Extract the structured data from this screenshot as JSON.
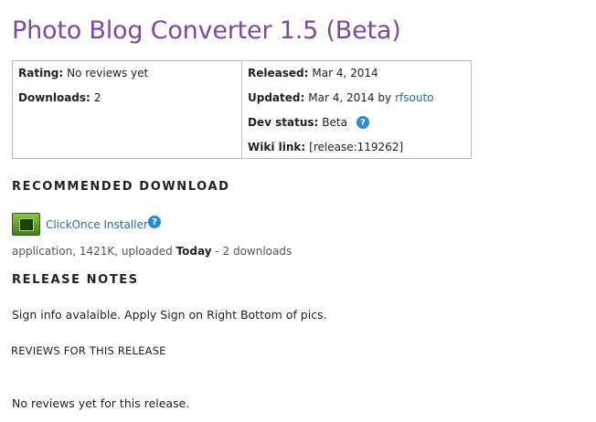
{
  "title": "Photo Blog Converter 1.5 (Beta)",
  "info": {
    "rating_label": "Rating:",
    "rating_value": "No reviews yet",
    "downloads_label": "Downloads:",
    "downloads_value": "2",
    "released_label": "Released:",
    "released_value": "Mar 4, 2014",
    "updated_label": "Updated:",
    "updated_value": "Mar 4, 2014 by",
    "updated_by": "rfsouto",
    "dev_status_label": "Dev status:",
    "dev_status_value": "Beta",
    "wiki_label": "Wiki link:",
    "wiki_value": "[release:119262]"
  },
  "recommended": {
    "heading": "RECOMMENDED DOWNLOAD",
    "installer_label": "ClickOnce Installer",
    "meta_prefix": "application, 1421K, uploaded",
    "meta_today": "Today",
    "meta_suffix": "- 2 downloads"
  },
  "release_notes": {
    "heading": "RELEASE NOTES",
    "text": "Sign info avalaible. Apply Sign on Right Bottom of pics."
  },
  "reviews": {
    "heading": "REVIEWS FOR THIS RELEASE",
    "text": "No reviews yet for this release."
  },
  "icons": {
    "help": "help-icon",
    "installer": "clickonce-installer-icon"
  },
  "colors": {
    "title": "#7d4a9c",
    "link": "#2a6ea8",
    "help_icon": "#2c8bd6"
  }
}
